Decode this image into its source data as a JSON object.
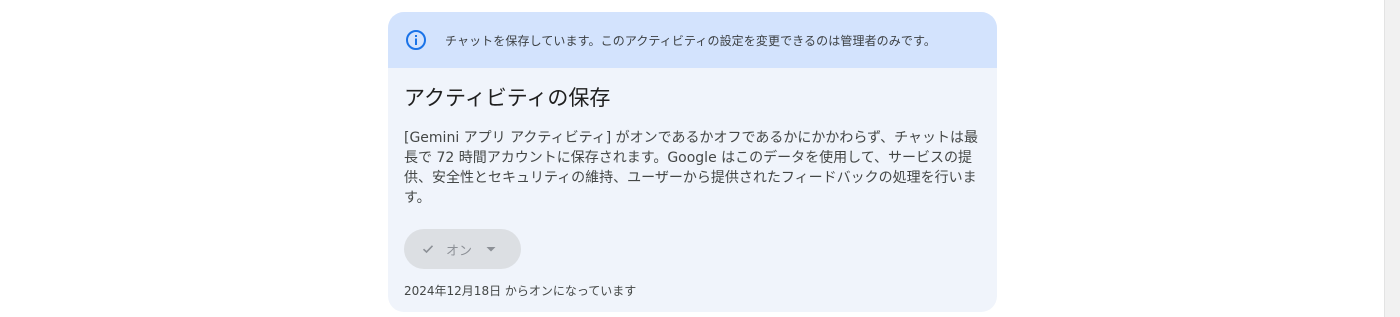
{
  "banner": {
    "icon": "info-icon",
    "text": "チャットを保存しています。このアクティビティの設定を変更できるのは管理者のみです。"
  },
  "section": {
    "title": "アクティビティの保存",
    "description": "[Gemini アプリ アクティビティ] がオンであるかオフであるかにかかわらず、チャットは最長で 72 時間アカウントに保存されます。Google はこのデータを使用して、サービスの提供、安全性とセキュリティの維持、ユーザーから提供されたフィードバックの処理を行います。"
  },
  "status": {
    "selected": "オン",
    "check_icon": "check-icon",
    "dropdown_icon": "caret-down-icon",
    "since": "2024年12月18日 からオンになっています"
  },
  "colors": {
    "banner_bg": "#d3e3fd",
    "card_bg": "#f0f4fb",
    "accent": "#1a73e8",
    "chip_bg": "#dcdfe3"
  }
}
